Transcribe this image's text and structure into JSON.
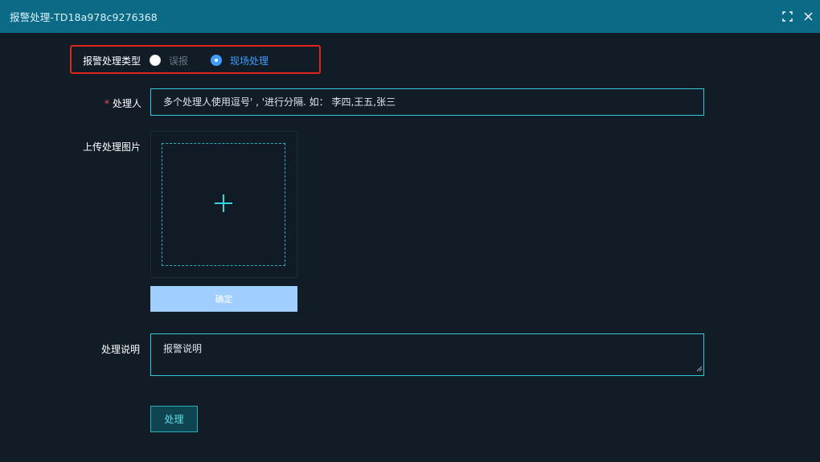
{
  "window": {
    "title": "报警处理-TD18a978c9276368",
    "maximize_icon": "maximize-icon",
    "close_icon": "close-icon"
  },
  "form": {
    "type": {
      "label": "报警处理类型",
      "options": [
        {
          "label": "误报",
          "selected": false
        },
        {
          "label": "现场处理",
          "selected": true
        }
      ]
    },
    "handler": {
      "required_mark": "*",
      "label": "处理人",
      "placeholder": "多个处理人使用逗号' , '进行分隔. 如： 李四,王五,张三"
    },
    "upload": {
      "label": "上传处理图片",
      "icon": "plus-icon",
      "confirm_label": "确定"
    },
    "description": {
      "label": "处理说明",
      "placeholder": "报警说明"
    },
    "submit_label": "处理"
  },
  "colors": {
    "titlebar": "#0b6a86",
    "background": "#111c27",
    "accent": "#31c9d6",
    "radio_selected": "#409eff",
    "highlight": "#e0241b",
    "confirm_button": "#a0cfff"
  }
}
